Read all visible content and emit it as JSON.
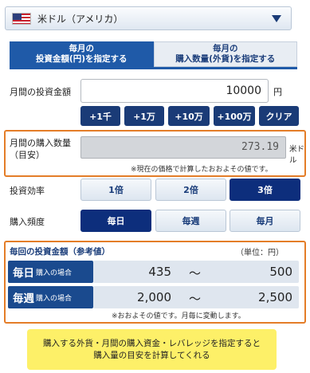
{
  "currency": {
    "label": "米ドル（アメリカ）",
    "flag_icon": "us-flag-icon",
    "arrow_icon": "chevron-down-icon"
  },
  "tabs": [
    {
      "line1": "毎月の",
      "line2": "投資金額(円)を指定する",
      "active": true
    },
    {
      "line1": "毎月の",
      "line2": "購入数量(外貨)を指定する",
      "active": false
    }
  ],
  "investment": {
    "label": "月間の投資金額",
    "value": "10000",
    "unit": "円",
    "buttons": [
      "+1千",
      "+1万",
      "+10万",
      "+100万",
      "クリア"
    ]
  },
  "quantity": {
    "label_line1": "月間の購入数量",
    "label_line2": "（目安）",
    "value": "273.19",
    "unit": "米ドル",
    "note": "※現在の価格で計算したおおよその値です。"
  },
  "efficiency": {
    "label": "投資効率",
    "options": [
      "1倍",
      "2倍",
      "3倍"
    ],
    "selected": "3倍"
  },
  "frequency": {
    "label": "購入頻度",
    "options": [
      "毎日",
      "毎週",
      "毎月"
    ],
    "selected": "毎日"
  },
  "reference": {
    "title": "毎回の投資金額（参考値）",
    "unit_note": "（単位：円）",
    "rows": [
      {
        "big": "毎日",
        "small": "購入の場合",
        "min": "435",
        "sep": "〜",
        "max": "500"
      },
      {
        "big": "毎週",
        "small": "購入の場合",
        "min": "2,000",
        "sep": "〜",
        "max": "2,500"
      }
    ],
    "note": "※おおよその値です。月毎に変動します。"
  },
  "callout": {
    "line1": "購入する外貨・月間の購入資金・レバレッジを指定すると",
    "line2": "購入量の目安を計算してくれる"
  },
  "colors": {
    "accent": "#1f5aa8",
    "selected": "#0d2e7c",
    "highlight_border": "#e47d28",
    "callout_bg": "#fdf068"
  }
}
